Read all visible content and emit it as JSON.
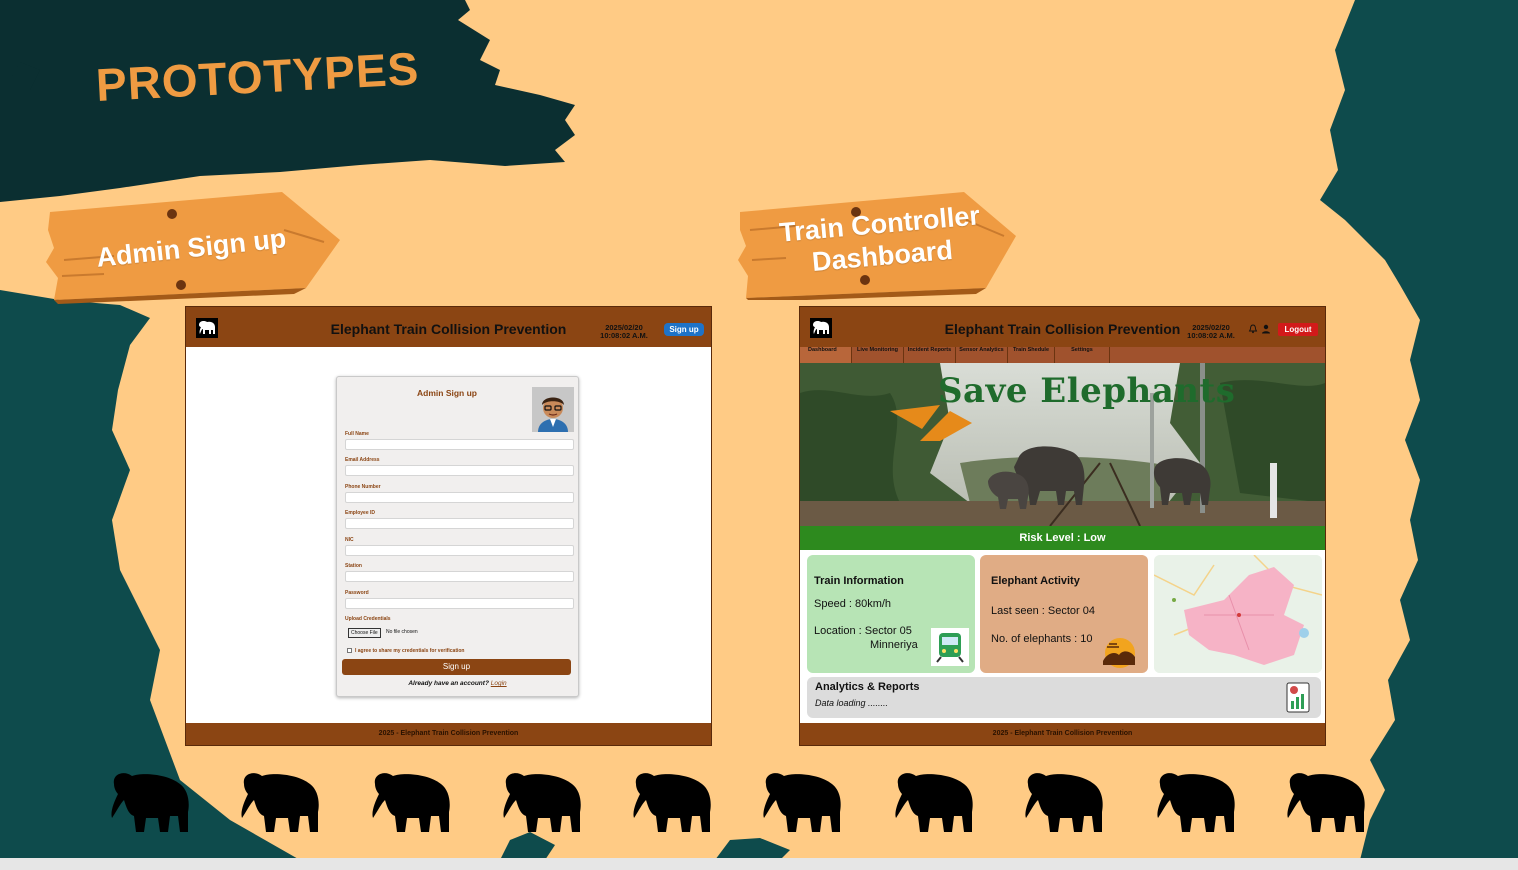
{
  "slide": {
    "title": "PROTOTYPES",
    "sign_left": "Admin Sign up",
    "sign_right_line1": "Train Controller",
    "sign_right_line2": "Dashboard"
  },
  "colors": {
    "brown": "#8b4513",
    "dark_teal": "#0b3f3f",
    "sand": "#ffcb85",
    "orange": "#ef9b42",
    "risk_green": "#2d8a1e",
    "logout_red": "#d21a1a",
    "signup_blue": "#1e73c8"
  },
  "signup_screen": {
    "app_title": "Elephant Train Collision Prevention",
    "date": "2025/02/20",
    "time": "10:08:02 A.M.",
    "signup_button": "Sign up",
    "form_title": "Admin Sign up",
    "fields": [
      {
        "label": "Full Name"
      },
      {
        "label": "Email Address"
      },
      {
        "label": "Phone Number"
      },
      {
        "label": "Employee ID"
      },
      {
        "label": "NIC"
      },
      {
        "label": "Station"
      },
      {
        "label": "Password"
      }
    ],
    "upload_label": "Upload Credentials",
    "choose_file": "Choose File",
    "no_file": "No file chosen",
    "agree": "I agree to share my credentials for verification",
    "submit": "Sign up",
    "already_text": "Already have an account?",
    "login_link": "Login",
    "footer": "2025 - Elephant Train Collision Prevention"
  },
  "dashboard_screen": {
    "app_title": "Elephant Train Collision Prevention",
    "date": "2025/02/20",
    "time": "10:08:02 A.M.",
    "logout": "Logout",
    "nav": [
      "Dashboard",
      "Live Monitoring",
      "Incident Reports",
      "Sensor Analytics",
      "Train Shedule",
      "Settings"
    ],
    "hero_title": "Save Elephants",
    "risk": "Risk Level : Low",
    "train_card": {
      "title": "Train Information",
      "speed": "Speed : 80km/h",
      "location": "Location : Sector 05",
      "location2": "Minneriya"
    },
    "elephant_card": {
      "title": "Elephant Activity",
      "last_seen": "Last seen : Sector 04",
      "count": "No. of elephants : 10"
    },
    "analytics": {
      "title": "Analytics & Reports",
      "status": "Data loading ........"
    },
    "footer": "2025 - Elephant Train Collision Prevention"
  }
}
